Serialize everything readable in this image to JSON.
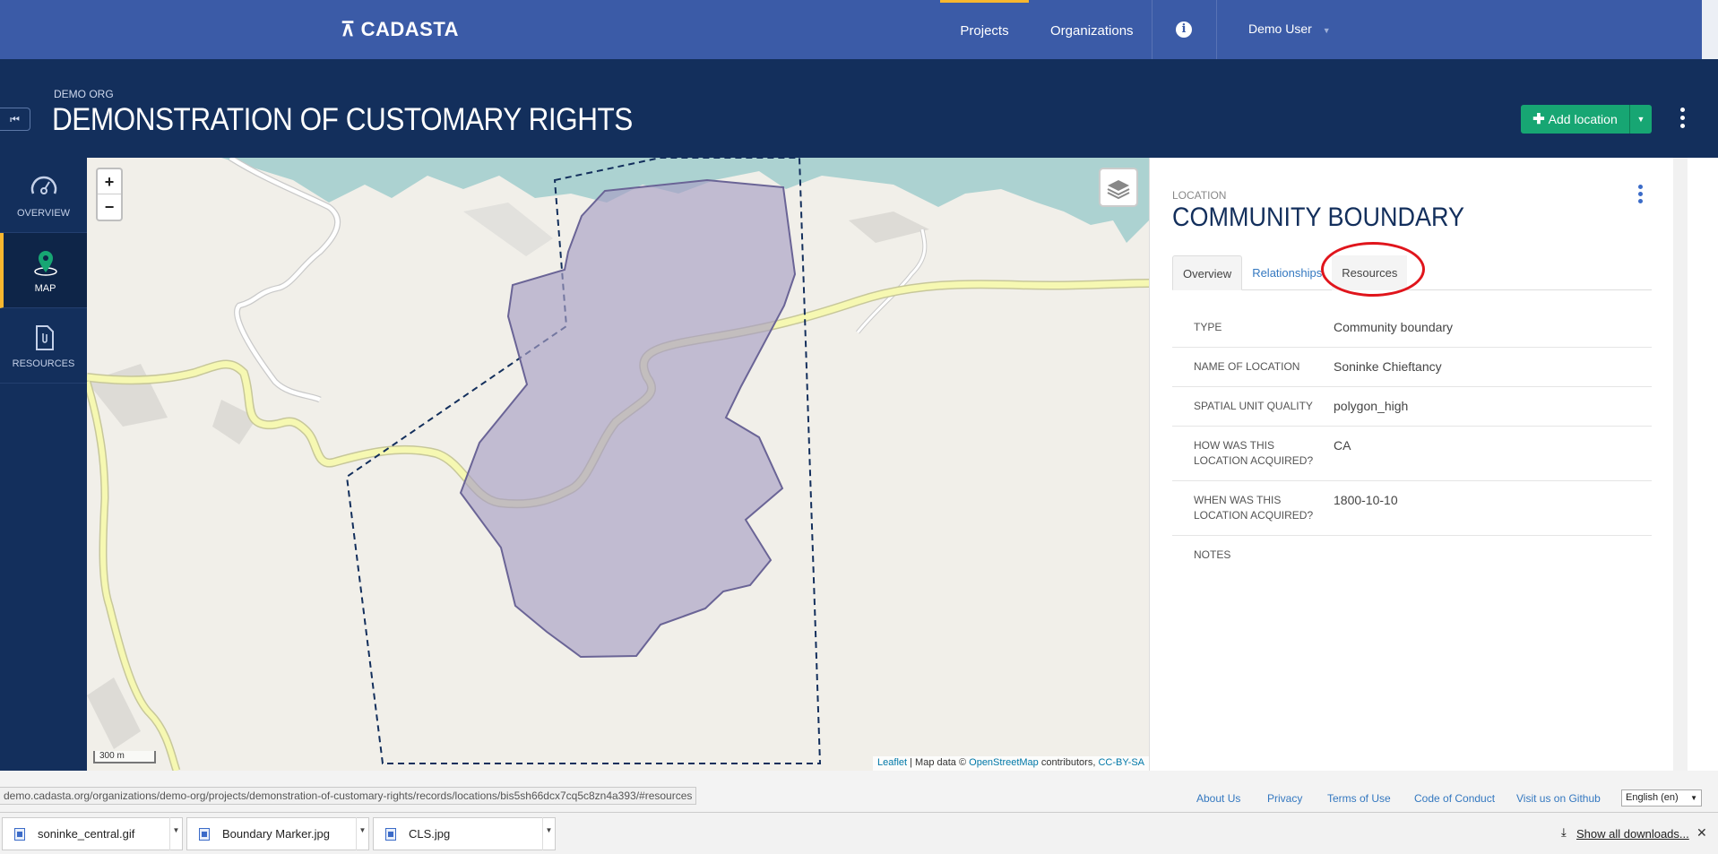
{
  "app": {
    "logo": "CADASTA",
    "nav": {
      "projects": "Projects",
      "organizations": "Organizations",
      "user": "Demo User"
    }
  },
  "header": {
    "org": "DEMO ORG",
    "title": "DEMONSTRATION OF CUSTOMARY RIGHTS",
    "add_location": "Add location"
  },
  "sidebar": {
    "items": [
      {
        "label": "OVERVIEW",
        "icon": "speedometer-icon"
      },
      {
        "label": "MAP",
        "icon": "map-pin-icon"
      },
      {
        "label": "RESOURCES",
        "icon": "document-icon"
      }
    ]
  },
  "map": {
    "zoom_in": "+",
    "zoom_out": "−",
    "scale": "300 m",
    "attribution": {
      "leaflet": "Leaflet",
      "sep": " | Map data © ",
      "osm": "OpenStreetMap",
      "contrib": " contributors, ",
      "license": "CC-BY-SA"
    }
  },
  "panel": {
    "label": "LOCATION",
    "title": "COMMUNITY BOUNDARY",
    "tabs": [
      "Overview",
      "Relationships",
      "Resources"
    ],
    "rows": [
      {
        "key": "TYPE",
        "value": "Community boundary"
      },
      {
        "key": "NAME OF LOCATION",
        "value": "Soninke Chieftancy"
      },
      {
        "key": "SPATIAL UNIT QUALITY",
        "value": "polygon_high"
      },
      {
        "key": "HOW WAS THIS LOCATION ACQUIRED?",
        "value": "CA"
      },
      {
        "key": "WHEN WAS THIS LOCATION ACQUIRED?",
        "value": "1800-10-10"
      },
      {
        "key": "NOTES",
        "value": ""
      }
    ]
  },
  "footer": {
    "status_url": "demo.cadasta.org/organizations/demo-org/projects/demonstration-of-customary-rights/records/locations/bis5sh66dcx7cq5c8zn4a393/#resources",
    "links": [
      "About Us",
      "Privacy",
      "Terms of Use",
      "Code of Conduct",
      "Visit us on Github"
    ],
    "language": "English (en)"
  },
  "downloads": {
    "files": [
      "soninke_central.gif",
      "Boundary Marker.jpg",
      "CLS.jpg"
    ],
    "show_all": "Show all downloads...",
    "close": "✕"
  },
  "colors": {
    "nav": "#3b5ba7",
    "header": "#132f5c",
    "accent": "#f7b72f",
    "add_button": "#17a673",
    "polygon": "#a79ec4"
  }
}
